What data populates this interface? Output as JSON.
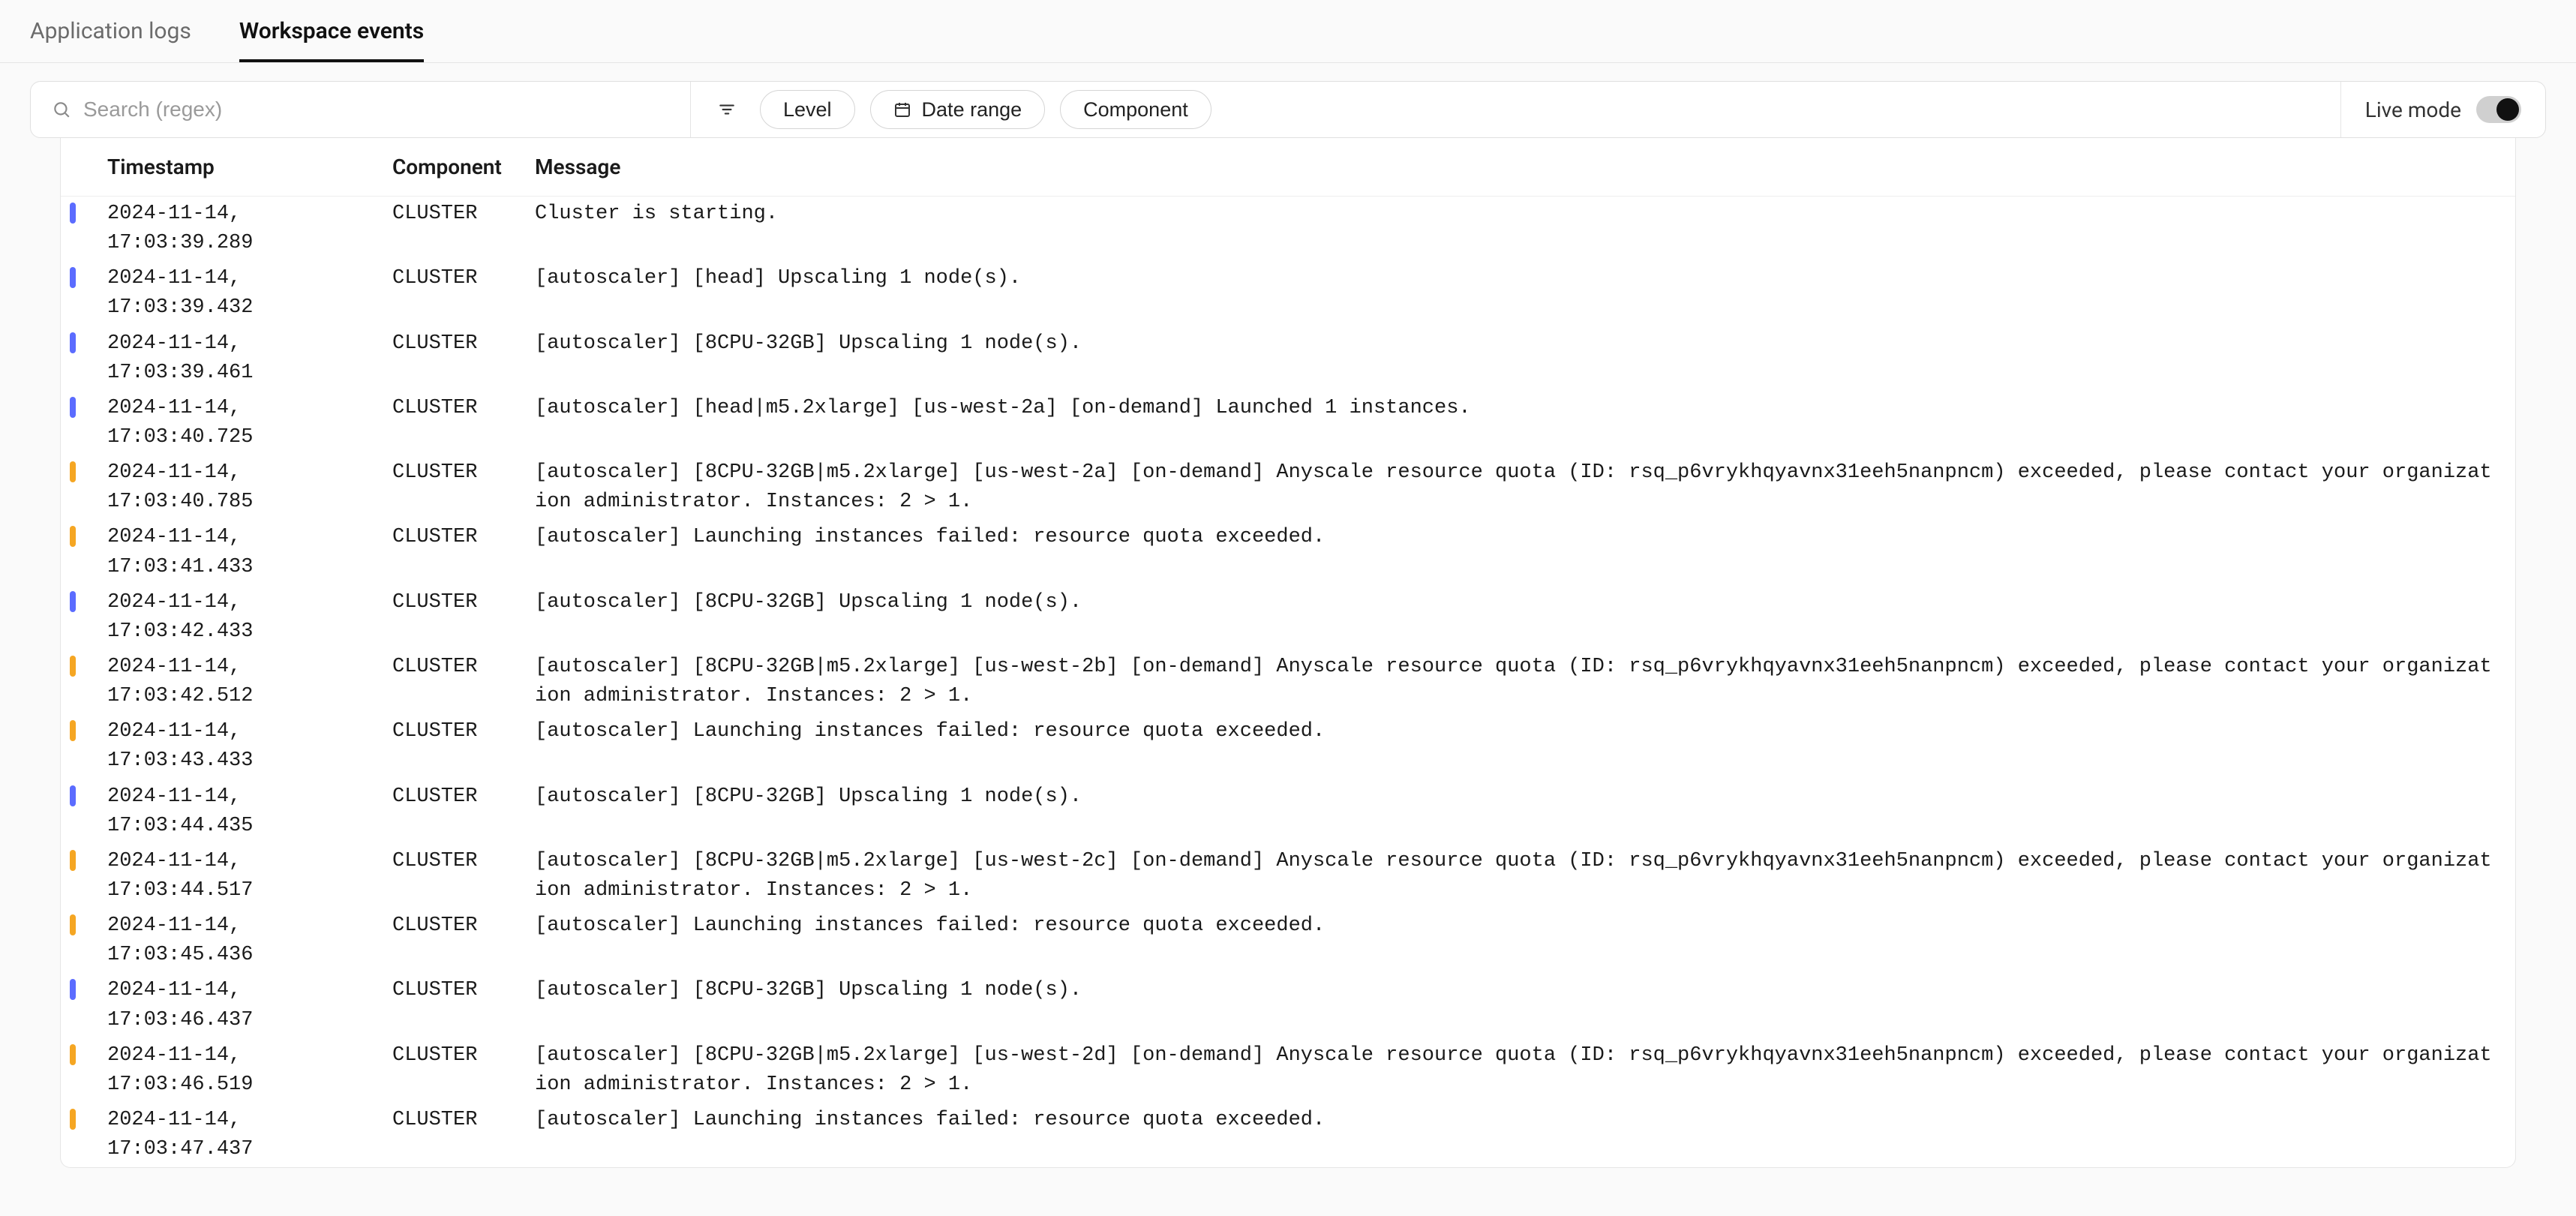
{
  "tabs": {
    "app_logs": "Application logs",
    "workspace_events": "Workspace events"
  },
  "toolbar": {
    "search_placeholder": "Search (regex)",
    "level_label": "Level",
    "date_range_label": "Date range",
    "component_label": "Component",
    "live_mode_label": "Live mode"
  },
  "columns": {
    "timestamp": "Timestamp",
    "component": "Component",
    "message": "Message"
  },
  "rows": [
    {
      "sev": "info",
      "ts": "2024-11-14, 17:03:39.289",
      "comp": "CLUSTER",
      "msg": "Cluster is starting."
    },
    {
      "sev": "info",
      "ts": "2024-11-14, 17:03:39.432",
      "comp": "CLUSTER",
      "msg": "[autoscaler] [head] Upscaling 1 node(s)."
    },
    {
      "sev": "info",
      "ts": "2024-11-14, 17:03:39.461",
      "comp": "CLUSTER",
      "msg": "[autoscaler] [8CPU-32GB] Upscaling 1 node(s)."
    },
    {
      "sev": "info",
      "ts": "2024-11-14, 17:03:40.725",
      "comp": "CLUSTER",
      "msg": "[autoscaler] [head|m5.2xlarge] [us-west-2a] [on-demand] Launched 1 instances."
    },
    {
      "sev": "warn",
      "ts": "2024-11-14, 17:03:40.785",
      "comp": "CLUSTER",
      "msg": "[autoscaler] [8CPU-32GB|m5.2xlarge] [us-west-2a] [on-demand] Anyscale resource quota (ID: rsq_p6vrykhqyavnx31eeh5nanpncm) exceeded, please contact your organization administrator. Instances: 2 > 1."
    },
    {
      "sev": "warn",
      "ts": "2024-11-14, 17:03:41.433",
      "comp": "CLUSTER",
      "msg": "[autoscaler] Launching instances failed: resource quota exceeded."
    },
    {
      "sev": "info",
      "ts": "2024-11-14, 17:03:42.433",
      "comp": "CLUSTER",
      "msg": "[autoscaler] [8CPU-32GB] Upscaling 1 node(s)."
    },
    {
      "sev": "warn",
      "ts": "2024-11-14, 17:03:42.512",
      "comp": "CLUSTER",
      "msg": "[autoscaler] [8CPU-32GB|m5.2xlarge] [us-west-2b] [on-demand] Anyscale resource quota (ID: rsq_p6vrykhqyavnx31eeh5nanpncm) exceeded, please contact your organization administrator. Instances: 2 > 1."
    },
    {
      "sev": "warn",
      "ts": "2024-11-14, 17:03:43.433",
      "comp": "CLUSTER",
      "msg": "[autoscaler] Launching instances failed: resource quota exceeded."
    },
    {
      "sev": "info",
      "ts": "2024-11-14, 17:03:44.435",
      "comp": "CLUSTER",
      "msg": "[autoscaler] [8CPU-32GB] Upscaling 1 node(s)."
    },
    {
      "sev": "warn",
      "ts": "2024-11-14, 17:03:44.517",
      "comp": "CLUSTER",
      "msg": "[autoscaler] [8CPU-32GB|m5.2xlarge] [us-west-2c] [on-demand] Anyscale resource quota (ID: rsq_p6vrykhqyavnx31eeh5nanpncm) exceeded, please contact your organization administrator. Instances: 2 > 1."
    },
    {
      "sev": "warn",
      "ts": "2024-11-14, 17:03:45.436",
      "comp": "CLUSTER",
      "msg": "[autoscaler] Launching instances failed: resource quota exceeded."
    },
    {
      "sev": "info",
      "ts": "2024-11-14, 17:03:46.437",
      "comp": "CLUSTER",
      "msg": "[autoscaler] [8CPU-32GB] Upscaling 1 node(s)."
    },
    {
      "sev": "warn",
      "ts": "2024-11-14, 17:03:46.519",
      "comp": "CLUSTER",
      "msg": "[autoscaler] [8CPU-32GB|m5.2xlarge] [us-west-2d] [on-demand] Anyscale resource quota (ID: rsq_p6vrykhqyavnx31eeh5nanpncm) exceeded, please contact your organization administrator. Instances: 2 > 1."
    },
    {
      "sev": "warn",
      "ts": "2024-11-14, 17:03:47.437",
      "comp": "CLUSTER",
      "msg": "[autoscaler] Launching instances failed: resource quota exceeded."
    }
  ]
}
